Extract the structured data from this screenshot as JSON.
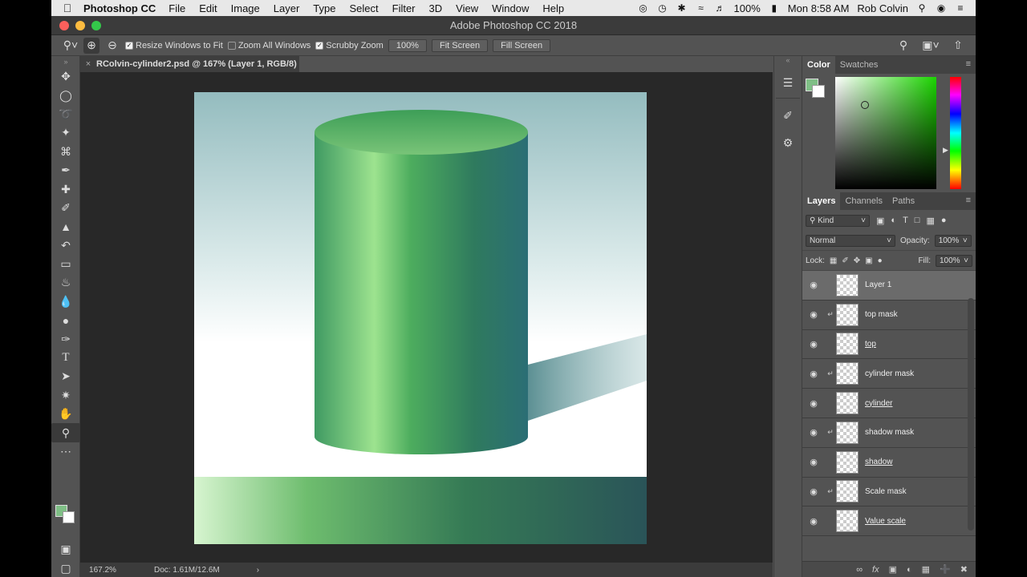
{
  "menubar": {
    "app": "Photoshop CC",
    "items": [
      "File",
      "Edit",
      "Image",
      "Layer",
      "Type",
      "Select",
      "Filter",
      "3D",
      "View",
      "Window",
      "Help"
    ],
    "battery": "100%",
    "clock": "Mon 8:58 AM",
    "user": "Rob Colvin"
  },
  "window": {
    "title": "Adobe Photoshop CC 2018"
  },
  "options": {
    "resize_label": "Resize Windows to Fit",
    "zoom_all_label": "Zoom All Windows",
    "scrubby_label": "Scrubby Zoom",
    "zoom_value": "100%",
    "fit_screen": "Fit Screen",
    "fill_screen": "Fill Screen"
  },
  "document": {
    "tab_label": "RColvin-cylinder2.psd @ 167% (Layer 1, RGB/8)",
    "close": "×"
  },
  "status": {
    "zoom": "167.2%",
    "doc": "Doc: 1.61M/12.6M",
    "arrow": "›"
  },
  "color_panel": {
    "tabs": [
      "Color",
      "Swatches"
    ],
    "fg": "#7fbf86",
    "bg": "#ffffff"
  },
  "layers_panel": {
    "tabs": [
      "Layers",
      "Channels",
      "Paths"
    ],
    "filter_label": "Kind",
    "blend_mode": "Normal",
    "opacity_label": "Opacity:",
    "opacity_value": "100%",
    "lock_label": "Lock:",
    "fill_label": "Fill:",
    "fill_value": "100%",
    "layers": [
      {
        "name": "Layer 1",
        "selected": true,
        "clipped": false,
        "underlined": false
      },
      {
        "name": "top mask",
        "selected": false,
        "clipped": true,
        "underlined": false
      },
      {
        "name": "top",
        "selected": false,
        "clipped": false,
        "underlined": true
      },
      {
        "name": "cylinder mask",
        "selected": false,
        "clipped": true,
        "underlined": false
      },
      {
        "name": "cylinder",
        "selected": false,
        "clipped": false,
        "underlined": true
      },
      {
        "name": "shadow mask",
        "selected": false,
        "clipped": true,
        "underlined": false
      },
      {
        "name": "shadow",
        "selected": false,
        "clipped": false,
        "underlined": true
      },
      {
        "name": "Scale mask",
        "selected": false,
        "clipped": true,
        "underlined": false
      },
      {
        "name": "Value scale",
        "selected": false,
        "clipped": false,
        "underlined": true
      }
    ]
  },
  "icons": {
    "tools": [
      "move-icon",
      "marquee-icon",
      "lasso-icon",
      "quick-select-icon",
      "crop-icon",
      "eyedropper-icon",
      "healing-icon",
      "brush-icon",
      "stamp-icon",
      "history-brush-icon",
      "eraser-icon",
      "paint-bucket-icon",
      "blur-icon",
      "dodge-icon",
      "pen-icon",
      "type-icon",
      "path-select-icon",
      "shape-icon",
      "hand-icon",
      "zoom-icon",
      "more-icon"
    ]
  }
}
